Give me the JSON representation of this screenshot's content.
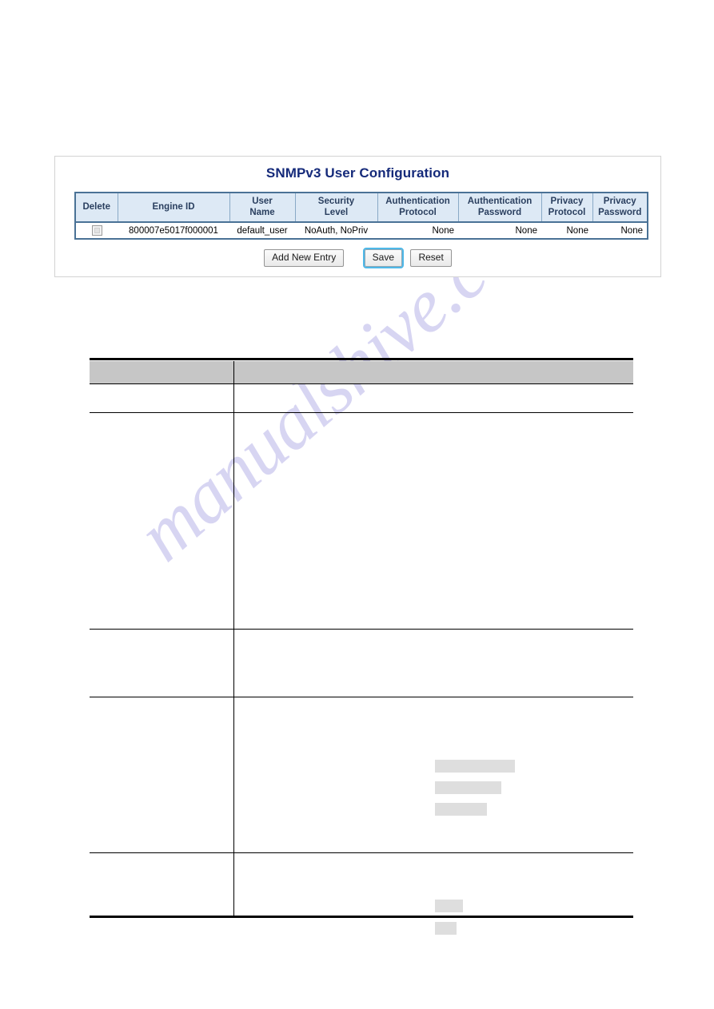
{
  "page": {
    "background_color": "#ffffff",
    "watermark_text": "manualshive.com",
    "watermark_color": "#c9c6ee"
  },
  "snmp_panel": {
    "title": "SNMPv3 User Configuration",
    "title_color": "#152a7a",
    "border_color": "#d3d3d3",
    "table": {
      "border_color": "#4a7296",
      "header_bg": "#dde9f5",
      "columns": [
        {
          "label_line1": "Delete",
          "label_line2": ""
        },
        {
          "label_line1": "Engine ID",
          "label_line2": ""
        },
        {
          "label_line1": "User",
          "label_line2": "Name"
        },
        {
          "label_line1": "Security",
          "label_line2": "Level"
        },
        {
          "label_line1": "Authentication",
          "label_line2": "Protocol"
        },
        {
          "label_line1": "Authentication",
          "label_line2": "Password"
        },
        {
          "label_line1": "Privacy",
          "label_line2": "Protocol"
        },
        {
          "label_line1": "Privacy",
          "label_line2": "Password"
        }
      ],
      "rows": [
        {
          "delete_checked": false,
          "engine_id": "800007e5017f000001",
          "user_name": "default_user",
          "security_level": "NoAuth, NoPriv",
          "auth_protocol": "None",
          "auth_password": "None",
          "privacy_protocol": "None",
          "privacy_password": "None"
        }
      ]
    },
    "buttons": {
      "add_new_entry": "Add New Entry",
      "save": "Save",
      "reset": "Reset",
      "focused": "Save",
      "focus_outline_color": "#4fb8e8"
    }
  },
  "doc_table": {
    "header_bg": "#c6c6c6",
    "rule_color": "#000000",
    "header": {
      "col1": "",
      "col2": ""
    },
    "rows": [
      {
        "col1": "",
        "col2": ""
      },
      {
        "col1": "",
        "col2": ""
      },
      {
        "col1": "",
        "col2": ""
      },
      {
        "col1": "",
        "col2": ""
      },
      {
        "col1": "",
        "col2": ""
      }
    ],
    "placeholder_color": "#dedede"
  }
}
